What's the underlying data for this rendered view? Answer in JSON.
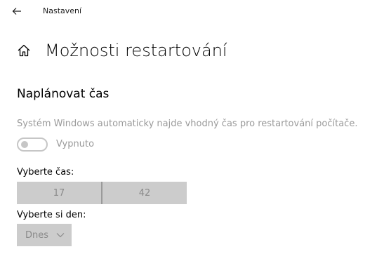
{
  "window": {
    "title": "Nastavení"
  },
  "header": {
    "title": "Možnosti restartování"
  },
  "section": {
    "title": "Naplánovat čas",
    "description": "Systém Windows automaticky najde vhodný čas pro restartování počítače."
  },
  "toggle": {
    "label": "Vypnuto",
    "state": "off"
  },
  "time": {
    "label": "Vyberte čas:",
    "hour": "17",
    "minute": "42"
  },
  "day": {
    "label": "Vyberte si den:",
    "value": "Dnes"
  },
  "icons": {
    "back": "back-arrow-icon",
    "home": "home-icon",
    "chevron": "chevron-down-icon"
  },
  "colors": {
    "disabled_text": "#9a9a9a",
    "disabled_fill": "#cccccc",
    "toggle_outline": "#c6c6c6"
  }
}
